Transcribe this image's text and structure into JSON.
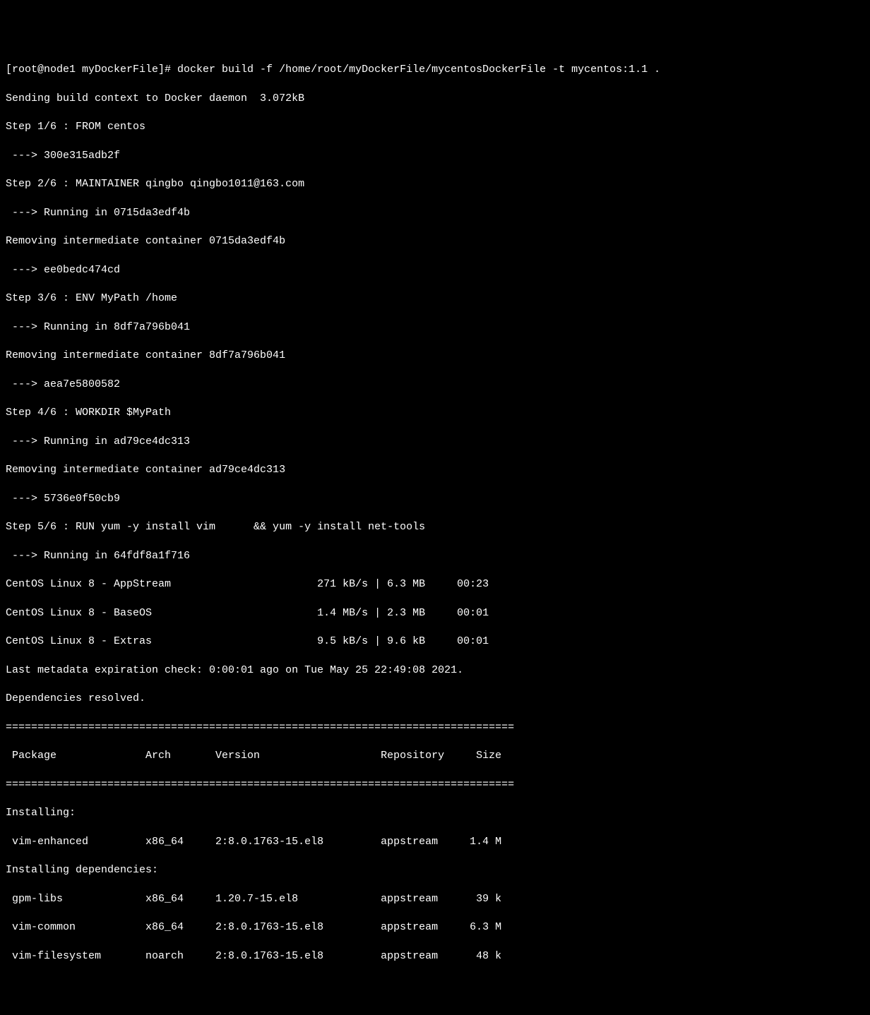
{
  "prompt": "[root@node1 myDockerFile]# docker build -f /home/root/myDockerFile/mycentosDockerFile -t mycentos:1.1 .",
  "line_context": "Sending build context to Docker daemon  3.072kB",
  "step1": "Step 1/6 : FROM centos",
  "step1_id": " ---> 300e315adb2f",
  "step2": "Step 2/6 : MAINTAINER qingbo qingbo1011@163.com",
  "step2_run": " ---> Running in 0715da3edf4b",
  "step2_remove": "Removing intermediate container 0715da3edf4b",
  "step2_id": " ---> ee0bedc474cd",
  "step3": "Step 3/6 : ENV MyPath /home",
  "step3_run": " ---> Running in 8df7a796b041",
  "step3_remove": "Removing intermediate container 8df7a796b041",
  "step3_id": " ---> aea7e5800582",
  "step4": "Step 4/6 : WORKDIR $MyPath",
  "step4_run": " ---> Running in ad79ce4dc313",
  "step4_remove": "Removing intermediate container ad79ce4dc313",
  "step4_id": " ---> 5736e0f50cb9",
  "step5": "Step 5/6 : RUN yum -y install vim      && yum -y install net-tools",
  "step5_run": " ---> Running in 64fdf8a1f716",
  "repo1": "CentOS Linux 8 - AppStream                       271 kB/s | 6.3 MB     00:23    ",
  "repo2": "CentOS Linux 8 - BaseOS                          1.4 MB/s | 2.3 MB     00:01    ",
  "repo3": "CentOS Linux 8 - Extras                          9.5 kB/s | 9.6 kB     00:01    ",
  "metadata": "Last metadata expiration check: 0:00:01 ago on Tue May 25 22:49:08 2021.",
  "deps_resolved": "Dependencies resolved.",
  "sep_thin": "================================================================================",
  "header": " Package              Arch       Version                   Repository     Size",
  "sep_thick": "================================================================================",
  "installing": "Installing:",
  "pkg1": " vim-enhanced         x86_64     2:8.0.1763-15.el8         appstream     1.4 M",
  "installing_deps": "Installing dependencies:",
  "pkg2": " gpm-libs             x86_64     1.20.7-15.el8             appstream      39 k",
  "pkg3": " vim-common           x86_64     2:8.0.1763-15.el8         appstream     6.3 M",
  "pkg4": " vim-filesystem       noarch     2:8.0.1763-15.el8         appstream      48 k"
}
